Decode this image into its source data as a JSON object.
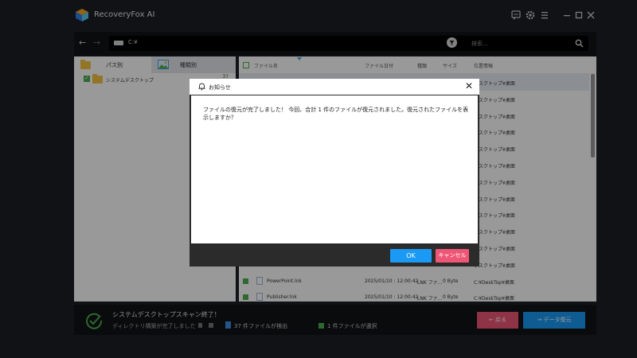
{
  "app": {
    "title": "RecoveryFox AI"
  },
  "titlebar": {
    "icons": [
      "chat-icon",
      "gear-icon",
      "menu-icon",
      "minimize-icon",
      "maximize-icon",
      "close-icon"
    ]
  },
  "address": {
    "path": "C:¥",
    "search_placeholder": "検索..."
  },
  "left_panel": {
    "tabs": [
      {
        "label": "パス別"
      },
      {
        "label": "種類別"
      }
    ],
    "tree": [
      {
        "label": "システムデスクトップ",
        "count": "37",
        "checked": true
      }
    ]
  },
  "file_list": {
    "headers": {
      "name": "ファイル名",
      "date": "ファイル日付",
      "type": "種類",
      "size": "サイズ",
      "location": "位置情報"
    },
    "rows": [
      {
        "location": "デスクトップ¥桌面"
      },
      {
        "location": "デスクトップ¥桌面"
      },
      {
        "location": "デスクトップ¥桌面"
      },
      {
        "location": "デスクトップ¥桌面"
      },
      {
        "location": "デスクトップ¥桌面"
      },
      {
        "location": "デスクトップ¥桌面"
      },
      {
        "location": "デスクトップ¥桌面"
      },
      {
        "location": "デスクトップ¥桌面"
      },
      {
        "location": "デスクトップ¥桌面"
      },
      {
        "location": "デスクトップ¥桌面"
      },
      {
        "location": "デスクトップ¥桌面"
      },
      {
        "location": "デスクトップ¥桌面"
      }
    ],
    "visible_rows": [
      {
        "name": "PowerPoint.lnk",
        "date": "2025/01/10 : 12:00:42",
        "type": "LNK ファ...",
        "size": "0 Byte",
        "location": "C:¥DeskTop¥桌面"
      },
      {
        "name": "Publisher.lnk",
        "date": "2025/01/10 : 12:00:42",
        "type": "LNK ファ...",
        "size": "0 Byte",
        "location": "C:¥DeskTop¥桌面"
      }
    ],
    "location_prefix": "¥DeskTop¥桌面"
  },
  "dialog": {
    "title": "お知らせ",
    "message": "ファイルの復元が完了しました！ 今回、合計 1 件のファイルが復元されました。復元されたファイルを表示しますか？",
    "ok_label": "OK",
    "cancel_label": "キャンセル"
  },
  "bottom": {
    "scan_title": "システムデスクトップスキャン終了！",
    "scan_sub": "ディレクトリ構築が完了しました",
    "found_text": "37 件ファイルが検出",
    "selected_text": "1 件ファイルが選択",
    "back_label": "戻る",
    "recover_label": "データ復元"
  },
  "colors": {
    "accent_blue": "#1a9af5",
    "accent_pink": "#ef5676",
    "check_green": "#4caf50",
    "folder_yellow": "#f6c344"
  }
}
